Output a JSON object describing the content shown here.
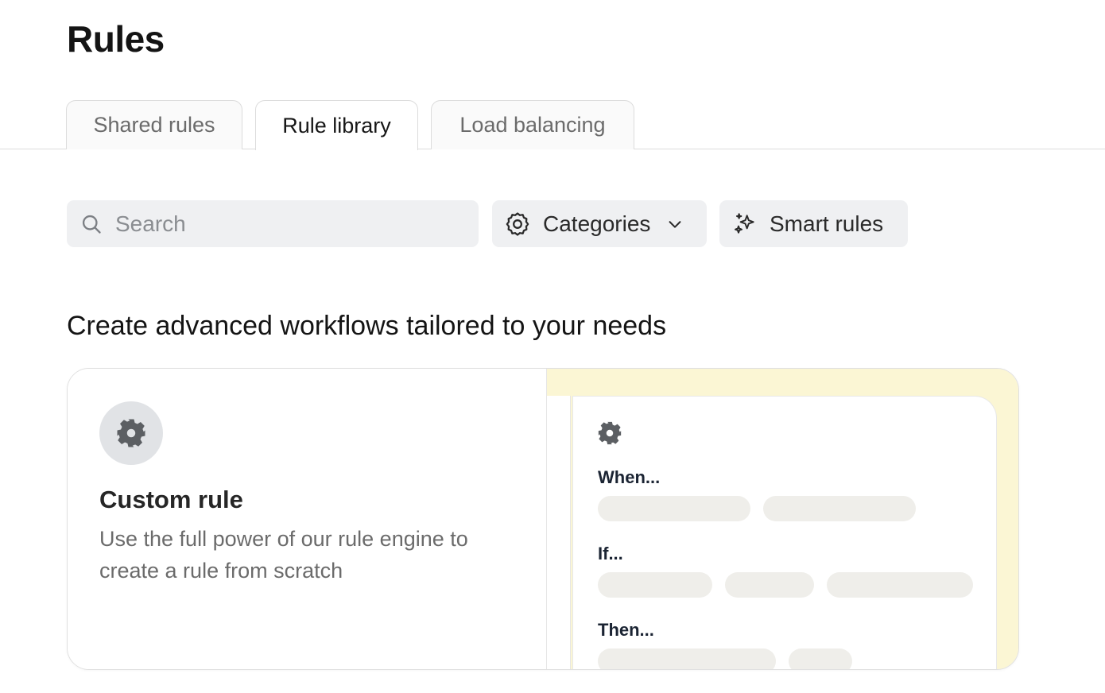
{
  "page": {
    "title": "Rules"
  },
  "tabs": [
    {
      "label": "Shared rules",
      "active": false
    },
    {
      "label": "Rule library",
      "active": true
    },
    {
      "label": "Load balancing",
      "active": false
    }
  ],
  "toolbar": {
    "search_placeholder": "Search",
    "categories_label": "Categories",
    "smart_rules_label": "Smart rules"
  },
  "section": {
    "heading": "Create advanced workflows tailored to your needs"
  },
  "card": {
    "icon": "gear-icon",
    "title": "Custom rule",
    "description": "Use the full power of our rule engine to create a rule from scratch",
    "preview": {
      "icon": "gear-icon",
      "when_label": "When...",
      "if_label": "If...",
      "then_label": "Then..."
    }
  },
  "colors": {
    "accent_preview_bg": "#fbf6d4",
    "pill_bg": "#eff0f2",
    "skeleton": "#efeeea"
  }
}
